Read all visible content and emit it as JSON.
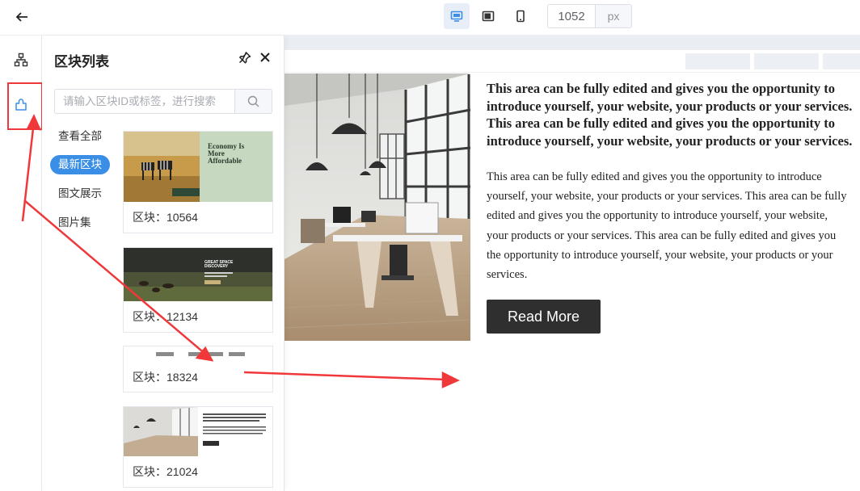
{
  "toolbar": {
    "width_value": "1052",
    "width_unit": "px"
  },
  "panel": {
    "title": "区块列表",
    "search_placeholder": "请输入区块ID或标签，进行搜索",
    "categories": [
      "查看全部",
      "最新区块",
      "图文展示",
      "图片集"
    ],
    "active_category": "最新区块"
  },
  "cards": [
    {
      "label": "区块：10564",
      "thumb_heading": "Economy Is More Affordable"
    },
    {
      "label": "区块：12134",
      "thumb_heading": "GREAT SPACE DISCOVERY"
    },
    {
      "label": "区块：18324"
    },
    {
      "label": "区块：21024"
    }
  ],
  "preview": {
    "heading_lines": [
      "This area can be fully edited and gives you the opportunity to",
      "introduce yourself, your website, your products or your services.",
      "This area can be fully edited and gives you the opportunity to",
      "introduce yourself, your website, your products or your services."
    ],
    "body_lines": [
      "This area can be fully edited and gives you the opportunity to introduce",
      "yourself, your website, your products or your services. This area can be fully",
      "edited and gives you the opportunity to introduce yourself, your website,",
      "your products or your services. This area can be fully edited and gives you",
      "the opportunity to introduce yourself, your website, your products or your",
      "services."
    ],
    "button_label": "Read More"
  },
  "colors": {
    "accent": "#3a8ee6",
    "annotation": "#f0383a",
    "button_dark": "#2f2f2f"
  },
  "icons": [
    "back-arrow-icon",
    "desktop-icon",
    "tablet-icon",
    "mobile-icon",
    "sitemap-icon",
    "block-icon",
    "pin-icon",
    "close-icon",
    "search-icon"
  ]
}
